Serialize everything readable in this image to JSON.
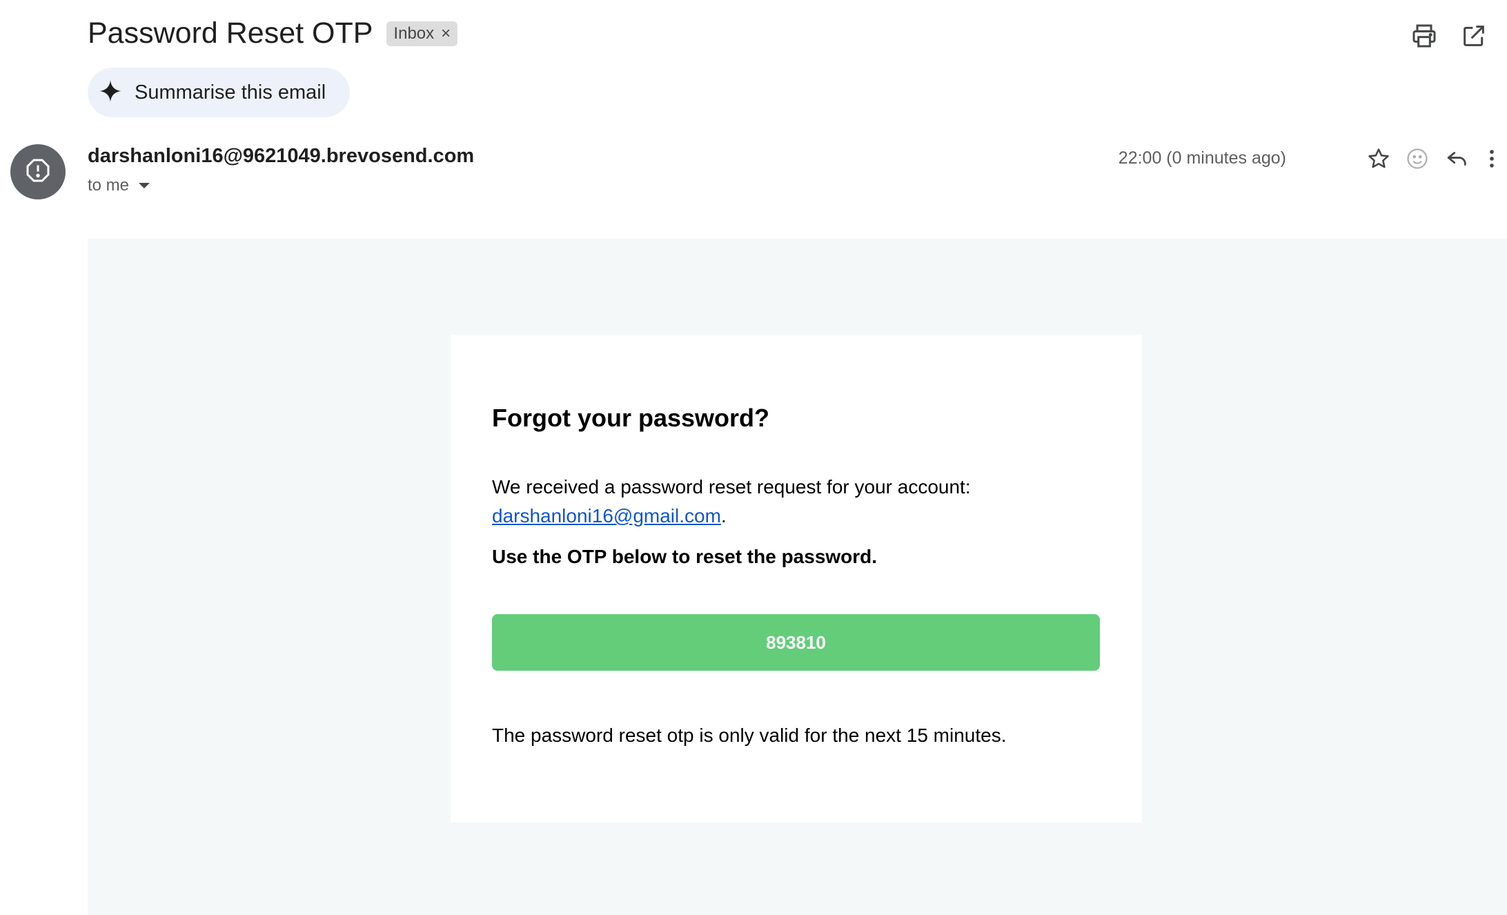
{
  "header": {
    "subject": "Password Reset OTP",
    "label_chip": "Inbox",
    "chip_close": "×",
    "print_icon": "print-icon",
    "open_new_window_icon": "open-in-new-icon"
  },
  "summarise": {
    "label": "Summarise this email",
    "icon": "sparkle-icon"
  },
  "message": {
    "sender": "darshanloni16@9621049.brevosend.com",
    "recipient": "to me",
    "time": "22:00 (0 minutes ago)",
    "avatar_icon": "warning-octagon-icon",
    "actions": [
      "star-icon",
      "emoji-icon",
      "reply-icon",
      "more-vert-icon"
    ]
  },
  "body": {
    "heading": "Forgot your password?",
    "request_text": "We received a password reset request for your account:",
    "account_email": "darshanloni16@gmail.com",
    "period": ".",
    "instruction": "Use the OTP below to reset the password.",
    "otp": "893810",
    "validity": "The password reset otp is only valid for the next 15 minutes."
  },
  "colors": {
    "otp_button": "#63cd7a",
    "body_background": "#f5f8f8",
    "link": "#1155cc",
    "summarise_bg": "#edf2fa",
    "avatar_bg": "#5f6368"
  }
}
